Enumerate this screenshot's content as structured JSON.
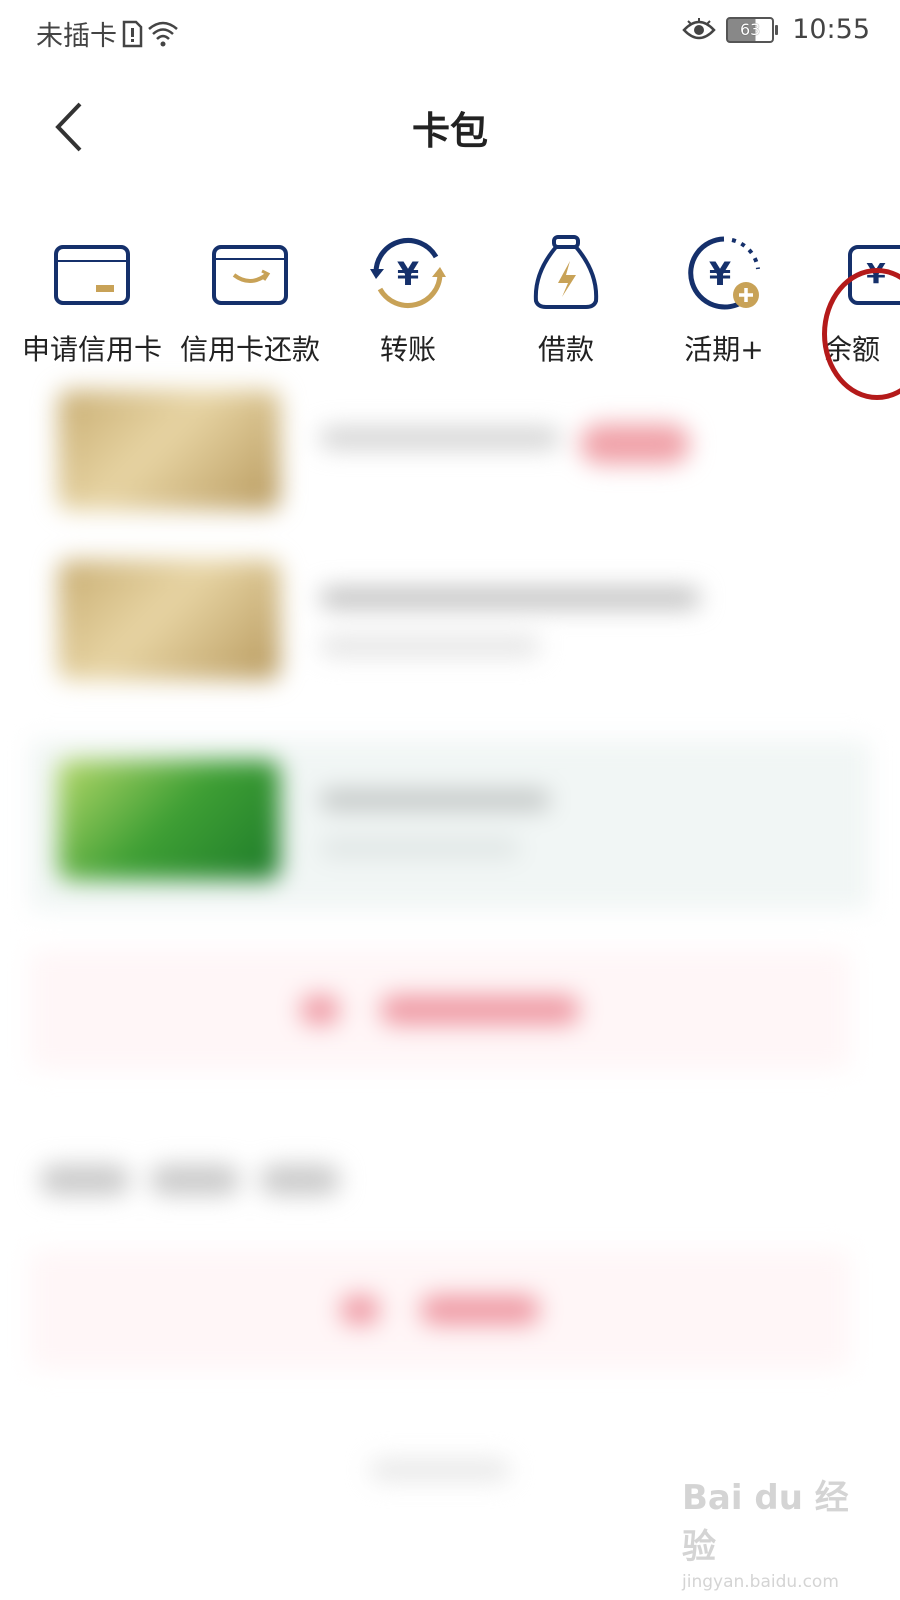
{
  "status_bar": {
    "carrier": "未插卡",
    "battery": "63",
    "time": "10:55"
  },
  "header": {
    "title": "卡包"
  },
  "quick_actions": [
    {
      "label": "申请信用卡",
      "icon": "credit-card-apply-icon"
    },
    {
      "label": "信用卡还款",
      "icon": "credit-card-repay-icon"
    },
    {
      "label": "转账",
      "icon": "yuan-transfer-icon"
    },
    {
      "label": "借款",
      "icon": "money-bag-icon"
    },
    {
      "label": "活期+",
      "icon": "yuan-plus-icon"
    },
    {
      "label": "余额",
      "icon": "yuan-wallet-icon"
    }
  ],
  "colors": {
    "navy": "#15306b",
    "gold": "#c8a257",
    "annotation_red": "#b41a1a"
  },
  "watermark": {
    "main": "Bai du 经验",
    "sub": "jingyan.baidu.com"
  }
}
